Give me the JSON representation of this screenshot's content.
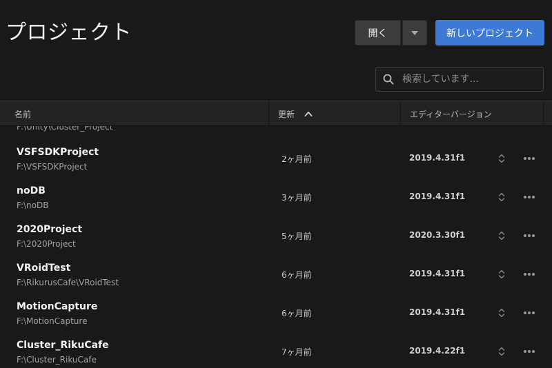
{
  "header": {
    "title": "プロジェクト",
    "open_label": "開く",
    "new_project_label": "新しいプロジェクト"
  },
  "search": {
    "placeholder": "検索しています..."
  },
  "table": {
    "columns": {
      "name": "名前",
      "updated": "更新",
      "version": "エディターバージョン"
    },
    "sort_column": "updated",
    "sort_direction": "ascending",
    "partial_row_path": "F:\\Unity\\Cluster_Project",
    "rows": [
      {
        "name": "VSFSDKProject",
        "path": "F:\\VSFSDKProject",
        "updated": "2ヶ月前",
        "version": "2019.4.31f1"
      },
      {
        "name": "noDB",
        "path": "F:\\noDB",
        "updated": "3ヶ月前",
        "version": "2019.4.31f1"
      },
      {
        "name": "2020Project",
        "path": "F:\\2020Project",
        "updated": "5ヶ月前",
        "version": "2020.3.30f1"
      },
      {
        "name": "VRoidTest",
        "path": "F:\\RikurusCafe\\VRoidTest",
        "updated": "6ヶ月前",
        "version": "2019.4.31f1"
      },
      {
        "name": "MotionCapture",
        "path": "F:\\MotionCapture",
        "updated": "6ヶ月前",
        "version": "2019.4.31f1"
      },
      {
        "name": "Cluster_RikuCafe",
        "path": "F:\\Cluster_RikuCafe",
        "updated": "7ヶ月前",
        "version": "2019.4.22f1"
      }
    ]
  },
  "colors": {
    "background": "#191919",
    "header_bar": "#232323",
    "primary_button": "#3d7ad6",
    "secondary_button": "#3c3c3c"
  },
  "icons": {
    "search": "search-icon",
    "dropdown": "chevron-down-icon",
    "sort": "chevron-up-icon",
    "version_select": "up-down-chevron-icon",
    "more": "more-horizontal-icon"
  }
}
